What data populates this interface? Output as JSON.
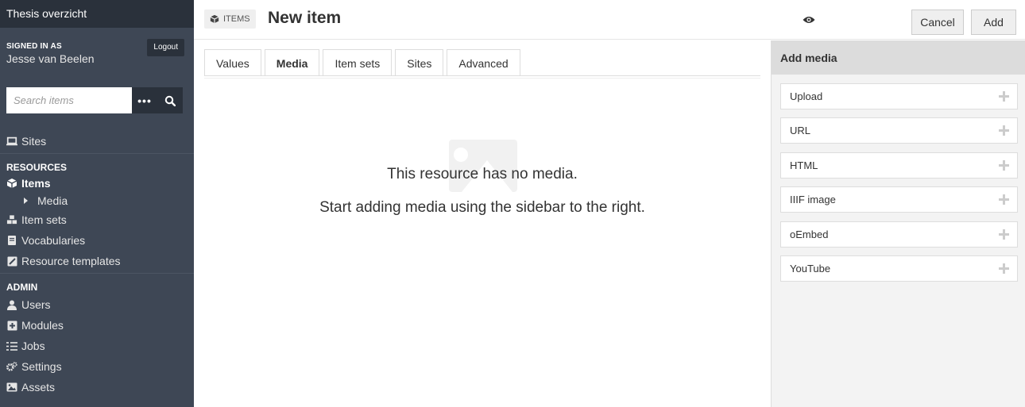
{
  "sidebar": {
    "site_title": "Thesis overzicht",
    "signed_in_label": "SIGNED IN AS",
    "user_name": "Jesse van Beelen",
    "logout_label": "Logout",
    "search_placeholder": "Search items",
    "search_options_label": "•••",
    "sites_label": "Sites",
    "resources_heading": "RESOURCES",
    "items_label": "Items",
    "media_label": "Media",
    "item_sets_label": "Item sets",
    "vocabularies_label": "Vocabularies",
    "resource_templates_label": "Resource templates",
    "admin_heading": "ADMIN",
    "users_label": "Users",
    "modules_label": "Modules",
    "jobs_label": "Jobs",
    "settings_label": "Settings",
    "assets_label": "Assets"
  },
  "header": {
    "breadcrumb": "ITEMS",
    "title": "New item",
    "cancel_label": "Cancel",
    "add_label": "Add"
  },
  "tabs": [
    {
      "label": "Values"
    },
    {
      "label": "Media"
    },
    {
      "label": "Item sets"
    },
    {
      "label": "Sites"
    },
    {
      "label": "Advanced"
    }
  ],
  "main": {
    "empty_line1": "This resource has no media.",
    "empty_line2": "Start adding media using the sidebar to the right."
  },
  "aside": {
    "heading": "Add media",
    "options": [
      {
        "label": "Upload"
      },
      {
        "label": "URL"
      },
      {
        "label": "HTML"
      },
      {
        "label": "IIIF image"
      },
      {
        "label": "oEmbed"
      },
      {
        "label": "YouTube"
      }
    ]
  },
  "colors": {
    "sidebar_bg": "#3e4755",
    "sidebar_title_bg": "#2a313b",
    "aside_bg": "#f3f3f3",
    "aside_head_bg": "#dcdcdc"
  }
}
